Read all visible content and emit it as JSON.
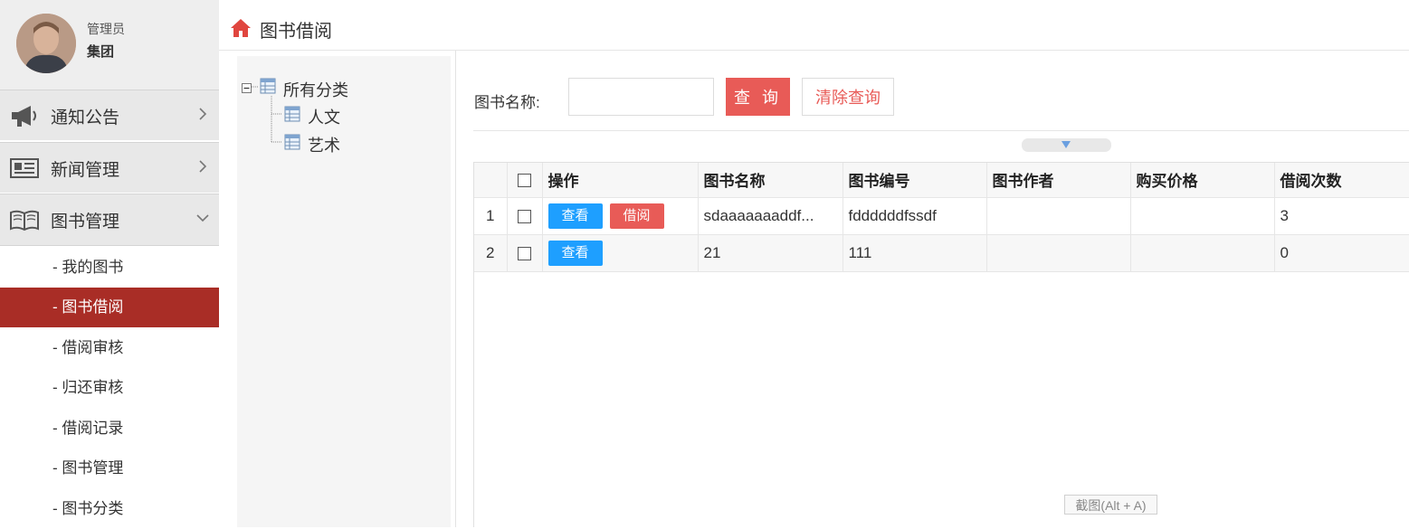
{
  "user": {
    "role": "管理员",
    "name": "集团"
  },
  "menu": [
    {
      "label": "通知公告",
      "icon": "megaphone-icon",
      "expanded": false
    },
    {
      "label": "新闻管理",
      "icon": "newspaper-icon",
      "expanded": false
    },
    {
      "label": "图书管理",
      "icon": "book-icon",
      "expanded": true
    }
  ],
  "submenu": [
    {
      "label": "- 我的图书",
      "active": false
    },
    {
      "label": "- 图书借阅",
      "active": true
    },
    {
      "label": "- 借阅审核",
      "active": false
    },
    {
      "label": "- 归还审核",
      "active": false
    },
    {
      "label": "- 借阅记录",
      "active": false
    },
    {
      "label": "- 图书管理",
      "active": false
    },
    {
      "label": "- 图书分类",
      "active": false
    }
  ],
  "header": {
    "title": "图书借阅",
    "icon": "home-icon"
  },
  "tree": {
    "root": "所有分类",
    "children": [
      "人文",
      "艺术"
    ]
  },
  "search": {
    "label": "图书名称:",
    "value": "",
    "query_button": "查 询",
    "clear_button": "清除查询"
  },
  "table": {
    "columns": [
      "",
      "",
      "操作",
      "图书名称",
      "图书编号",
      "图书作者",
      "购买价格",
      "借阅次数"
    ],
    "view_label": "查看",
    "borrow_label": "借阅",
    "rows": [
      {
        "num": "1",
        "name": "sdaaaaaaaddf...",
        "code": "fddddddfssdf",
        "author": "",
        "price": "",
        "count": "3",
        "can_borrow": true
      },
      {
        "num": "2",
        "name": "21",
        "code": "111",
        "author": "",
        "price": "",
        "count": "0",
        "can_borrow": false
      }
    ]
  },
  "overlay_hint": "截图(Alt + A)",
  "colors": {
    "accent": "#a92d26",
    "danger": "#e85b57",
    "primary": "#1e9fff"
  }
}
